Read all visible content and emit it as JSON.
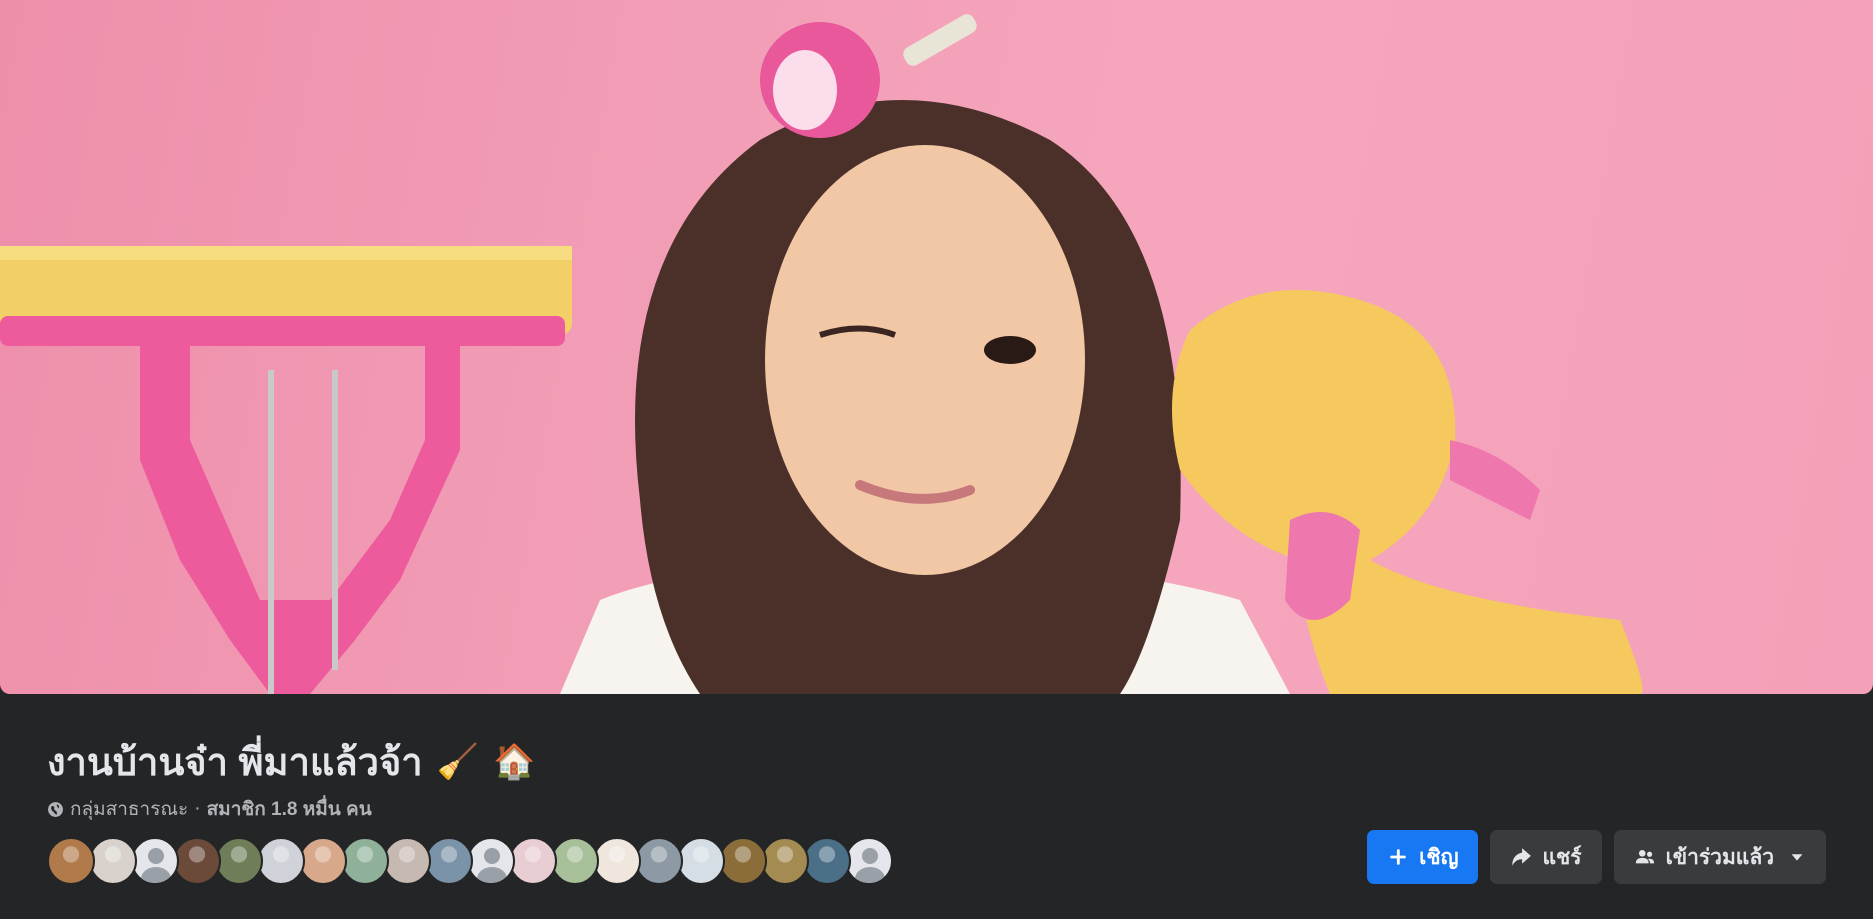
{
  "cover": {
    "description_alt": ""
  },
  "group": {
    "title": "งานบ้านจ๋า พี่มาแล้วจ้า",
    "title_emojis": [
      "🧹",
      "🏠"
    ],
    "privacy": "กลุ่มสาธารณะ",
    "separator": "·",
    "members": "สมาชิก 1.8 หมื่น คน"
  },
  "member_avatars": [
    {
      "type": "photo",
      "color": "#b07a4a"
    },
    {
      "type": "photo",
      "color": "#d9d2cc"
    },
    {
      "type": "placeholder"
    },
    {
      "type": "photo",
      "color": "#6b4a3a"
    },
    {
      "type": "photo",
      "color": "#6f7d59"
    },
    {
      "type": "photo",
      "color": "#cfd3d9"
    },
    {
      "type": "photo",
      "color": "#d7a98a"
    },
    {
      "type": "photo",
      "color": "#8fb19a"
    },
    {
      "type": "photo",
      "color": "#c6b9b2"
    },
    {
      "type": "photo",
      "color": "#7b93a8"
    },
    {
      "type": "placeholder"
    },
    {
      "type": "photo",
      "color": "#e8cdd3"
    },
    {
      "type": "photo",
      "color": "#a7c09a"
    },
    {
      "type": "photo",
      "color": "#efe6de"
    },
    {
      "type": "photo",
      "color": "#8d9aa6"
    },
    {
      "type": "photo",
      "color": "#d4dee4"
    },
    {
      "type": "photo",
      "color": "#8b6d3a"
    },
    {
      "type": "photo",
      "color": "#a38b52"
    },
    {
      "type": "photo",
      "color": "#4b6f87"
    },
    {
      "type": "placeholder"
    }
  ],
  "actions": {
    "invite": "เชิญ",
    "share": "แชร์",
    "joined": "เข้าร่วมแล้ว"
  },
  "colors": {
    "background": "#242526",
    "button_primary": "#1877f2",
    "button_secondary": "#3a3b3c"
  },
  "icons": [
    "globe-icon",
    "plus-icon",
    "share-icon",
    "members-icon",
    "caret-down-icon"
  ]
}
